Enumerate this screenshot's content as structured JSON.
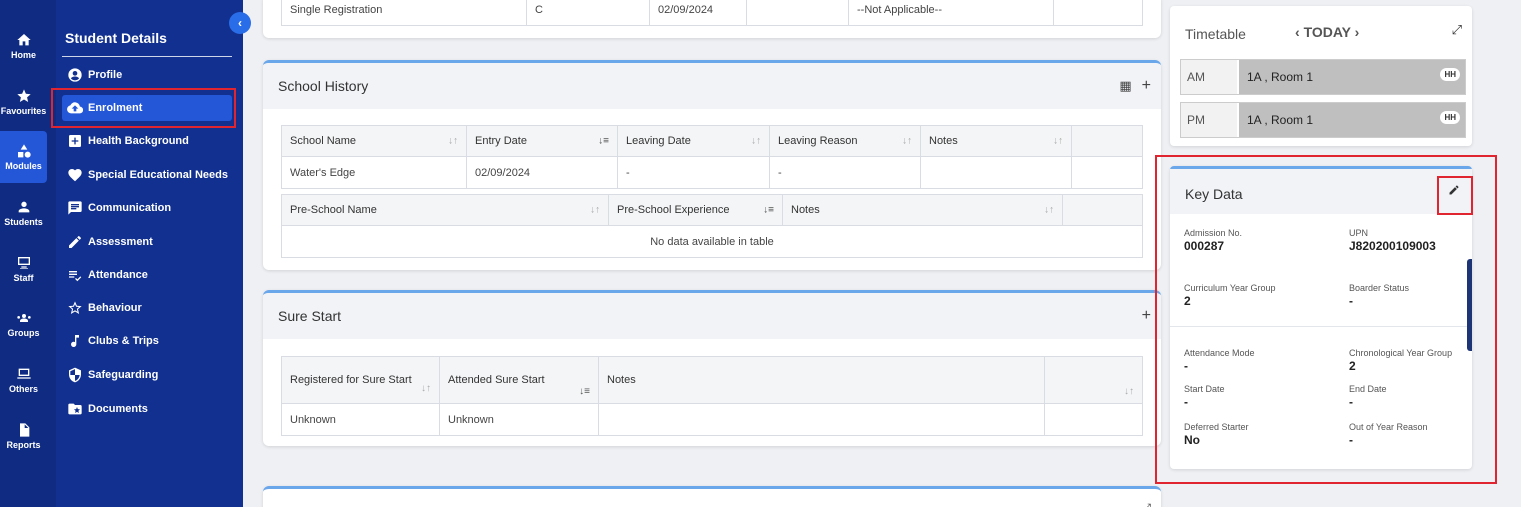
{
  "rail": [
    {
      "label": "Home",
      "icon": "home-icon"
    },
    {
      "label": "Favourites",
      "icon": "star-icon"
    },
    {
      "label": "Modules",
      "icon": "modules-icon"
    },
    {
      "label": "Students",
      "icon": "person-icon"
    },
    {
      "label": "Staff",
      "icon": "staff-icon"
    },
    {
      "label": "Groups",
      "icon": "groups-icon"
    },
    {
      "label": "Others",
      "icon": "others-icon"
    },
    {
      "label": "Reports",
      "icon": "reports-icon"
    }
  ],
  "sidebar": {
    "title": "Student Details",
    "items": [
      {
        "label": "Profile",
        "icon": "account-circle-icon"
      },
      {
        "label": "Enrolment",
        "icon": "cloud-upload-icon"
      },
      {
        "label": "Health Background",
        "icon": "medical-plus-icon"
      },
      {
        "label": "Special Educational Needs",
        "icon": "heart-icon"
      },
      {
        "label": "Communication",
        "icon": "message-icon"
      },
      {
        "label": "Assessment",
        "icon": "pencil-icon"
      },
      {
        "label": "Attendance",
        "icon": "checklist-icon"
      },
      {
        "label": "Behaviour",
        "icon": "star-outline-icon"
      },
      {
        "label": "Clubs & Trips",
        "icon": "music-note-icon"
      },
      {
        "label": "Safeguarding",
        "icon": "shield-icon"
      },
      {
        "label": "Documents",
        "icon": "folder-star-icon"
      }
    ]
  },
  "top_row": [
    "Single Registration",
    "C",
    "02/09/2024",
    "",
    "--Not Applicable--",
    ""
  ],
  "school_history": {
    "title": "School History",
    "headers": [
      "School Name",
      "Entry Date",
      "Leaving Date",
      "Leaving Reason",
      "Notes"
    ],
    "rows": [
      [
        "Water's Edge",
        "02/09/2024",
        "-",
        "-",
        ""
      ]
    ],
    "pre_headers": [
      "Pre-School Name",
      "Pre-School Experience",
      "Notes"
    ],
    "pre_empty": "No data available in table"
  },
  "sure_start": {
    "title": "Sure Start",
    "headers": [
      "Registered for Sure Start",
      "Attended Sure Start",
      "Notes"
    ],
    "rows": [
      [
        "Unknown",
        "Unknown",
        ""
      ]
    ]
  },
  "timetable": {
    "title": "Timetable",
    "nav": "TODAY",
    "rows": [
      {
        "slot": "AM",
        "class": "1A , Room 1",
        "badge": "HH"
      },
      {
        "slot": "PM",
        "class": "1A , Room 1",
        "badge": "HH"
      }
    ]
  },
  "key_data": {
    "title": "Key Data",
    "fields": [
      {
        "label": "Admission No.",
        "value": "000287"
      },
      {
        "label": "UPN",
        "value": "J820200109003"
      },
      {
        "label": "Curriculum Year Group",
        "value": "2"
      },
      {
        "label": "Boarder Status",
        "value": "-"
      },
      {
        "label": "Attendance Mode",
        "value": "-"
      },
      {
        "label": "Chronological Year Group",
        "value": "2"
      },
      {
        "label": "Start Date",
        "value": "-"
      },
      {
        "label": "End Date",
        "value": "-"
      },
      {
        "label": "Deferred Starter",
        "value": "No"
      },
      {
        "label": "Out of Year Reason",
        "value": "-"
      }
    ]
  },
  "colors": {
    "rail": "#0f2c82",
    "sidebar": "#11308f",
    "active": "#2456d8",
    "highlight": "#e02430",
    "accent": "#6aa6ea"
  }
}
